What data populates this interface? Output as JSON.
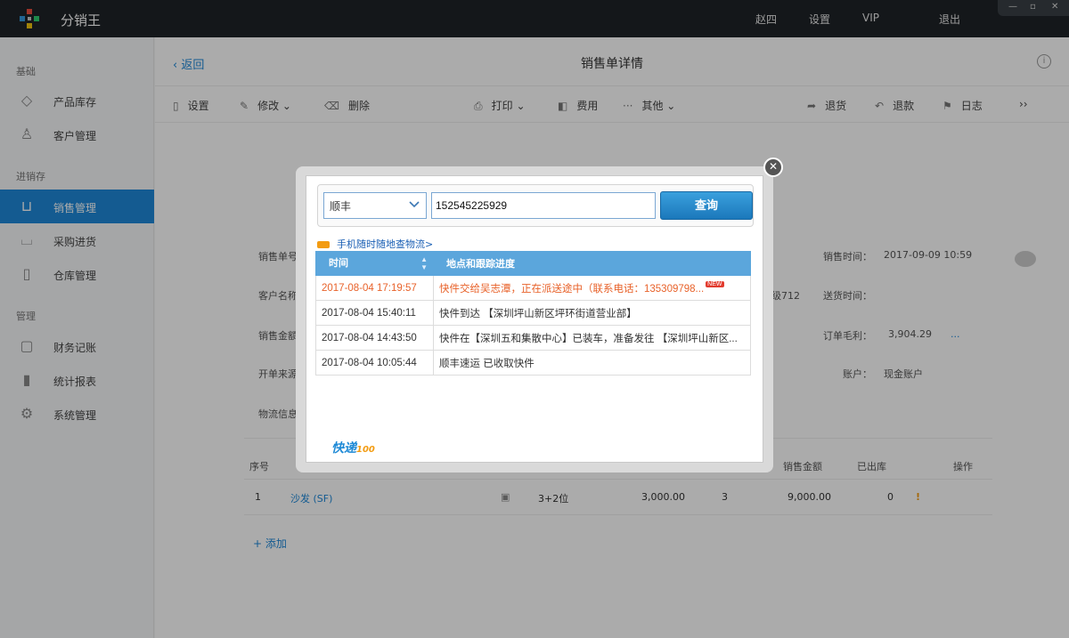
{
  "app": {
    "name": "分销王"
  },
  "topnav": {
    "user": "赵四",
    "settings": "设置",
    "vip": "VIP",
    "logout": "退出"
  },
  "sidebar": {
    "sections": [
      "基础",
      "进销存",
      "管理"
    ],
    "items": [
      {
        "label": "产品库存",
        "icon": "tag-icon"
      },
      {
        "label": "客户管理",
        "icon": "user-icon"
      },
      {
        "label": "销售管理",
        "icon": "cart-icon"
      },
      {
        "label": "采购进货",
        "icon": "basket-icon"
      },
      {
        "label": "仓库管理",
        "icon": "book-icon"
      },
      {
        "label": "财务记账",
        "icon": "ledger-icon"
      },
      {
        "label": "统计报表",
        "icon": "bar-chart-icon"
      },
      {
        "label": "系统管理",
        "icon": "gear-icon"
      }
    ]
  },
  "header": {
    "back": "返回",
    "title": "销售单详情"
  },
  "toolbar": {
    "settings": "设置",
    "edit": "修改",
    "delete": "删除",
    "print": "打印",
    "fee": "费用",
    "other": "其他",
    "return_goods": "退货",
    "refund": "退款",
    "log": "日志"
  },
  "detail": {
    "order_no_label": "销售单号",
    "customer_label": "客户名称",
    "amount_label": "销售金额",
    "source_label": "开单来源",
    "logistics_label": "物流信息",
    "sale_time_label": "销售时间：",
    "sale_time": "2017-09-09 10:59",
    "partial_code": "级712",
    "ship_time_label": "送货时间：",
    "gross_profit_label": "订单毛利：",
    "gross_profit": "3,904.29",
    "account_label": "账户：",
    "account": "现金账户"
  },
  "grid": {
    "headers": {
      "no": "序号",
      "sale_amount": "销售金额",
      "shipped": "已出库",
      "action": "操作"
    },
    "row": {
      "no": "1",
      "product": "沙发 (SF)",
      "spec": "3+2位",
      "price": "3,000.00",
      "qty": "3",
      "amount": "9,000.00",
      "shipped": "0"
    },
    "add": "添加"
  },
  "dialog": {
    "carrier": "顺丰",
    "tracking_no": "152545225929",
    "query_button": "查询",
    "mobile_link": "手机随时随地查物流>",
    "columns": [
      "时间",
      "地点和跟踪进度"
    ],
    "rows": [
      {
        "time": "2017-08-04 17:19:57",
        "progress": "快件交给吴志潭，正在派送途中（联系电话：135309798...",
        "badge": "NEW"
      },
      {
        "time": "2017-08-04 15:40:11",
        "progress": "快件到达 【深圳坪山新区坪环街道营业部】"
      },
      {
        "time": "2017-08-04 14:43:50",
        "progress": "快件在【深圳五和集散中心】已装车，准备发往 【深圳坪山新区..."
      },
      {
        "time": "2017-08-04 10:05:44",
        "progress": "顺丰速运 已收取快件"
      }
    ],
    "logo": {
      "text": "快递",
      "suffix": "100"
    }
  }
}
